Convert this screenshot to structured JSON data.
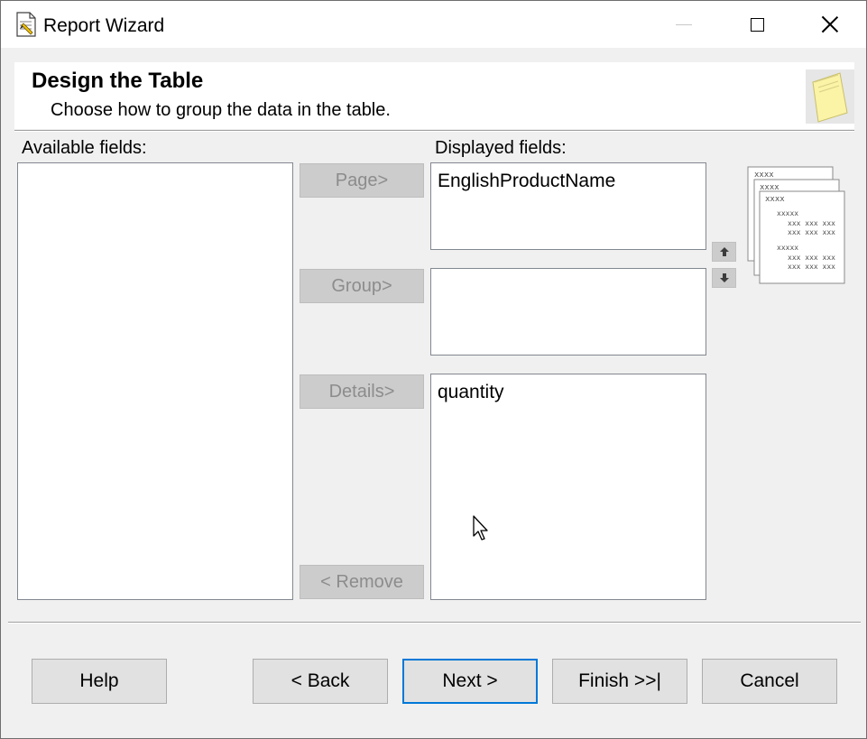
{
  "window": {
    "title": "Report Wizard"
  },
  "header": {
    "title": "Design the Table",
    "subtitle": "Choose how to group the data in the table."
  },
  "available": {
    "label": "Available fields:",
    "items": []
  },
  "displayed": {
    "label": "Displayed fields:",
    "page_items": [
      "EnglishProductName"
    ],
    "group_items": [],
    "details_items": [
      "quantity"
    ]
  },
  "actions": {
    "page": "Page>",
    "group": "Group>",
    "details": "Details>",
    "remove": "< Remove"
  },
  "preview": {
    "level1": "xxxx",
    "level2": "xxxx",
    "level3": "xxxx",
    "group_a": "xxxxx",
    "group_b": "xxxxx",
    "row": "xxx xxx xxx"
  },
  "footer": {
    "help": "Help",
    "back": "< Back",
    "next": "Next >",
    "finish": "Finish >>|",
    "cancel": "Cancel"
  },
  "colors": {
    "default_button_border": "#0078d7",
    "disabled_button_bg": "#cccccc",
    "disabled_text": "#8c8c8c"
  }
}
